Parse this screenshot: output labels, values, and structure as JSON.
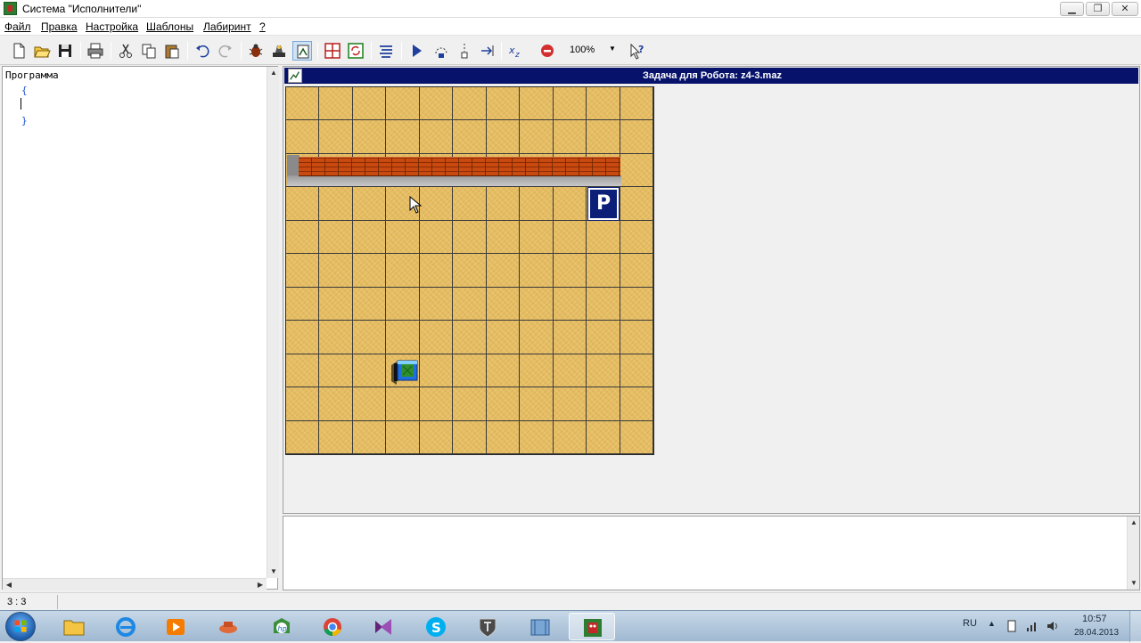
{
  "window": {
    "title": "Система \"Исполнители\""
  },
  "menu": [
    "Файл",
    "Правка",
    "Настройка",
    "Шаблоны",
    "Лабиринт",
    "?"
  ],
  "toolbar": {
    "zoom": "100%"
  },
  "editor": {
    "keyword": "Программа",
    "open_brace": "{",
    "close_brace": "}"
  },
  "field": {
    "header": "Задача для Робота: z4-3.maz",
    "columns": 11,
    "rows": 11,
    "target_label": "P",
    "robot_cell": {
      "col": 3,
      "row": 8
    },
    "target_cell": {
      "col": 9,
      "row": 3
    }
  },
  "status": {
    "position": "3 : 3"
  },
  "tray": {
    "lang": "RU",
    "time": "10:57",
    "date": "28.04.2013"
  }
}
